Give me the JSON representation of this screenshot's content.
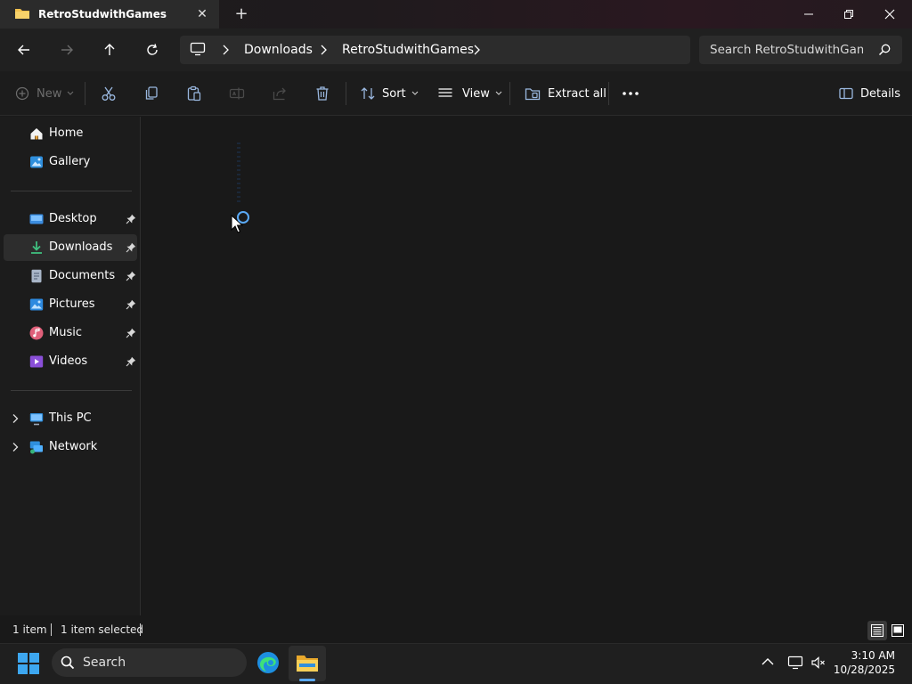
{
  "window": {
    "tab_title": "RetroStudwithGames",
    "tab_close_icon": "close-icon",
    "new_tab_icon": "plus-icon"
  },
  "address": {
    "crumbs": [
      "Downloads",
      "RetroStudwithGames"
    ],
    "root_icon": "monitor-icon"
  },
  "search": {
    "placeholder": "Search RetroStudwithGames"
  },
  "toolbar": {
    "new_label": "New",
    "sort_label": "Sort",
    "view_label": "View",
    "extract_label": "Extract all",
    "details_label": "Details"
  },
  "sidebar": {
    "items": [
      {
        "label": "Home",
        "icon": "home-icon"
      },
      {
        "label": "Gallery",
        "icon": "gallery-icon"
      },
      {
        "label": "Desktop",
        "icon": "desktop-icon",
        "pinned": true
      },
      {
        "label": "Downloads",
        "icon": "download-icon",
        "pinned": true,
        "selected": true
      },
      {
        "label": "Documents",
        "icon": "document-icon",
        "pinned": true
      },
      {
        "label": "Pictures",
        "icon": "pictures-icon",
        "pinned": true
      },
      {
        "label": "Music",
        "icon": "music-icon",
        "pinned": true
      },
      {
        "label": "Videos",
        "icon": "video-icon",
        "pinned": true
      },
      {
        "label": "This PC",
        "icon": "pc-icon"
      },
      {
        "label": "Network",
        "icon": "network-icon"
      }
    ]
  },
  "status": {
    "count": "1 item",
    "selected": "1 item selected"
  },
  "taskbar": {
    "search_label": "Search",
    "time": "3:10 AM",
    "date": "10/28/2025"
  },
  "colors": {
    "accent": "#5aa9f5",
    "folder": "#f2c14e",
    "background": "#191919"
  }
}
